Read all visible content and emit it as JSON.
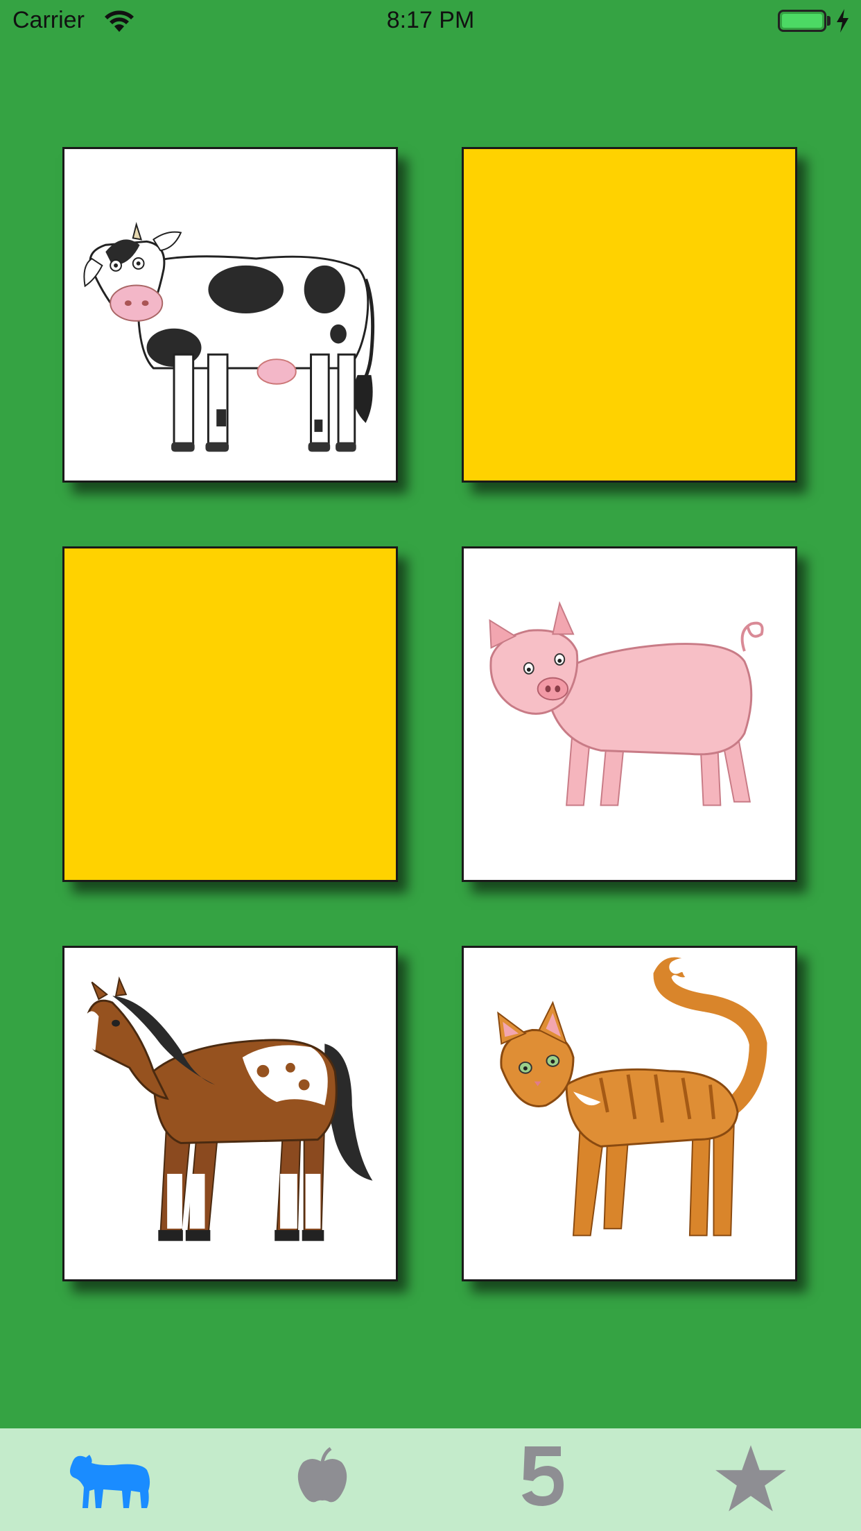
{
  "status_bar": {
    "carrier": "Carrier",
    "time": "8:17 PM",
    "battery_level": 1.0
  },
  "board": {
    "cards": [
      {
        "state": "face-up",
        "animal": "cow"
      },
      {
        "state": "face-down",
        "color": "#ffd200"
      },
      {
        "state": "face-down",
        "color": "#ffd200"
      },
      {
        "state": "face-up",
        "animal": "pig"
      },
      {
        "state": "face-up",
        "animal": "horse"
      },
      {
        "state": "face-up",
        "animal": "cat"
      }
    ]
  },
  "tab_bar": {
    "selected_index": 0,
    "selected_color": "#1a8cff",
    "unselected_color": "#8e8e93",
    "tabs": [
      {
        "icon": "cow-icon",
        "label": ""
      },
      {
        "icon": "apple-icon",
        "label": ""
      },
      {
        "icon": "number-five-icon",
        "glyph": "5",
        "label": ""
      },
      {
        "icon": "star-icon",
        "label": ""
      }
    ]
  },
  "colors": {
    "background": "#35a343",
    "card_back": "#ffd200",
    "tab_bar_background": "#c4ebcb"
  }
}
